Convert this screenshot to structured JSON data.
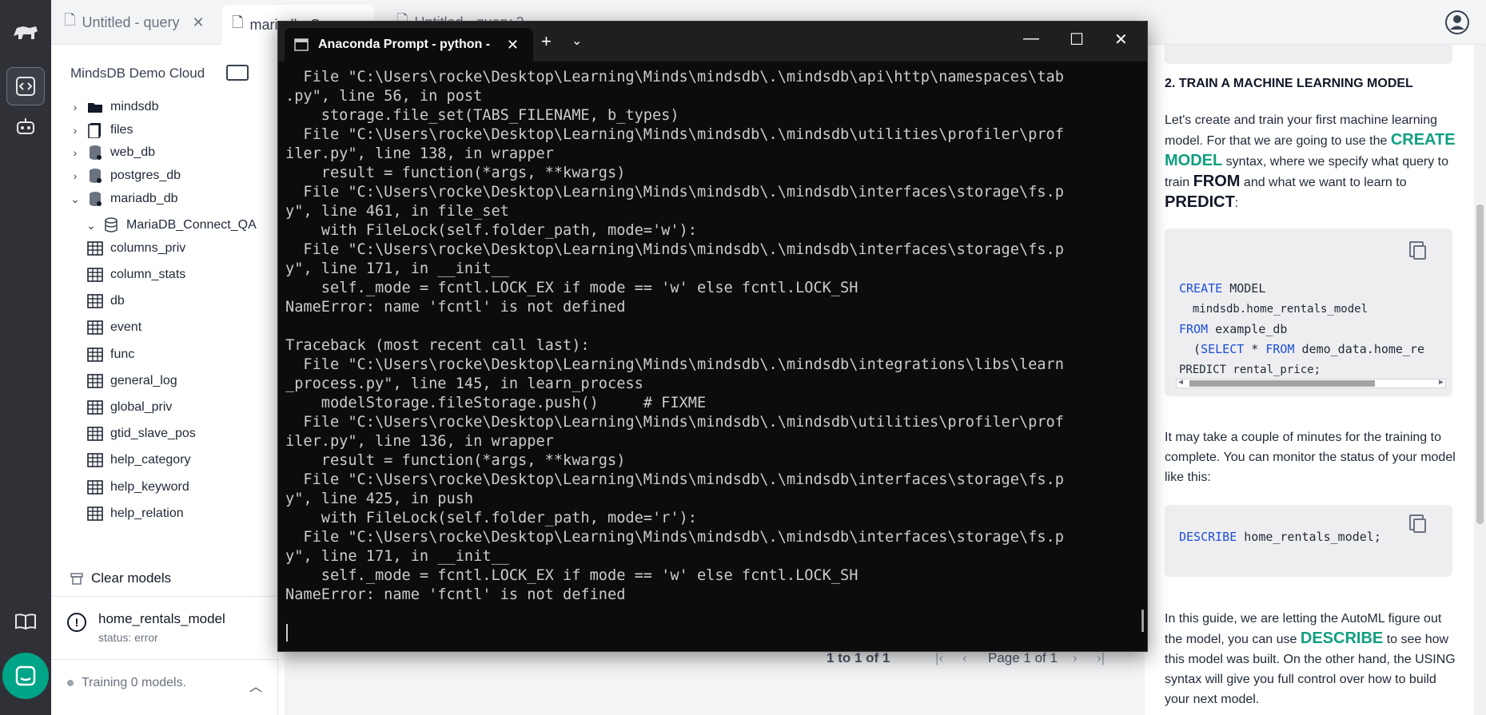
{
  "tabs": [
    {
      "label": "Untitled - query"
    },
    {
      "label": "mariadb_Conne..."
    },
    {
      "label": "Untitled - query 2"
    }
  ],
  "sidebar": {
    "title": "MindsDB Demo Cloud",
    "tree": [
      {
        "label": "mindsdb",
        "kind": "folder"
      },
      {
        "label": "files",
        "kind": "files"
      },
      {
        "label": "web_db",
        "kind": "db"
      },
      {
        "label": "postgres_db",
        "kind": "db"
      },
      {
        "label": "mariadb_db",
        "kind": "db"
      },
      {
        "label": "MariaDB_Connect_QA",
        "kind": "db"
      },
      {
        "label": "columns_priv",
        "kind": "table"
      },
      {
        "label": "column_stats",
        "kind": "table"
      },
      {
        "label": "db",
        "kind": "table"
      },
      {
        "label": "event",
        "kind": "table"
      },
      {
        "label": "func",
        "kind": "table"
      },
      {
        "label": "general_log",
        "kind": "table"
      },
      {
        "label": "global_priv",
        "kind": "table"
      },
      {
        "label": "gtid_slave_pos",
        "kind": "table"
      },
      {
        "label": "help_category",
        "kind": "table"
      },
      {
        "label": "help_keyword",
        "kind": "table"
      },
      {
        "label": "help_relation",
        "kind": "table"
      }
    ],
    "clear_models": "Clear models",
    "model": {
      "name": "home_rentals_model",
      "status": "status: error"
    },
    "training": "Training 0 models."
  },
  "results": {
    "range": "1 to 1 of 1",
    "page": "Page 1 of 1"
  },
  "terminal": {
    "title": "Anaconda Prompt - python -",
    "lines": [
      "  File \"C:\\Users\\rocke\\Desktop\\Learning\\Minds\\mindsdb\\.\\mindsdb\\api\\http\\namespaces\\tab",
      ".py\", line 56, in post",
      "    storage.file_set(TABS_FILENAME, b_types)",
      "  File \"C:\\Users\\rocke\\Desktop\\Learning\\Minds\\mindsdb\\.\\mindsdb\\utilities\\profiler\\prof",
      "iler.py\", line 138, in wrapper",
      "    result = function(*args, **kwargs)",
      "  File \"C:\\Users\\rocke\\Desktop\\Learning\\Minds\\mindsdb\\.\\mindsdb\\interfaces\\storage\\fs.p",
      "y\", line 461, in file_set",
      "    with FileLock(self.folder_path, mode='w'):",
      "  File \"C:\\Users\\rocke\\Desktop\\Learning\\Minds\\mindsdb\\.\\mindsdb\\interfaces\\storage\\fs.p",
      "y\", line 171, in __init__",
      "    self._mode = fcntl.LOCK_EX if mode == 'w' else fcntl.LOCK_SH",
      "NameError: name 'fcntl' is not defined",
      "",
      "Traceback (most recent call last):",
      "  File \"C:\\Users\\rocke\\Desktop\\Learning\\Minds\\mindsdb\\.\\mindsdb\\integrations\\libs\\learn",
      "_process.py\", line 145, in learn_process",
      "    modelStorage.fileStorage.push()     # FIXME",
      "  File \"C:\\Users\\rocke\\Desktop\\Learning\\Minds\\mindsdb\\.\\mindsdb\\utilities\\profiler\\prof",
      "iler.py\", line 136, in wrapper",
      "    result = function(*args, **kwargs)",
      "  File \"C:\\Users\\rocke\\Desktop\\Learning\\Minds\\mindsdb\\.\\mindsdb\\interfaces\\storage\\fs.p",
      "y\", line 425, in push",
      "    with FileLock(self.folder_path, mode='r'):",
      "  File \"C:\\Users\\rocke\\Desktop\\Learning\\Minds\\mindsdb\\.\\mindsdb\\interfaces\\storage\\fs.p",
      "y\", line 171, in __init__",
      "    self._mode = fcntl.LOCK_EX if mode == 'w' else fcntl.LOCK_SH",
      "NameError: name 'fcntl' is not defined"
    ]
  },
  "guide": {
    "heading": "2. TRAIN A MACHINE LEARNING MODEL",
    "p1_a": "Let's create and train your first machine learning model. For that we are going to use the ",
    "p1_kw1": "CREATE MODEL",
    "p1_b": " syntax, where we specify what query to train ",
    "p1_kw2": "FROM",
    "p1_c": " and what we want to learn to ",
    "p1_kw3": "PREDICT",
    "p1_d": ":",
    "code1": {
      "l1_kw": "CREATE",
      "l1_rest": " MODEL",
      "l2": "  mindsdb.home_rentals_model",
      "l3_kw": "FROM",
      "l3_rest": " example_db",
      "l4_pre": "  (",
      "l4_kw1": "SELECT",
      "l4_mid": " * ",
      "l4_kw2": "FROM",
      "l4_rest": " demo_data.home_re",
      "l5": "PREDICT rental_price;"
    },
    "p2": "It may take a couple of minutes for the training to complete. You can monitor the status of your model like this:",
    "code2": {
      "kw": "DESCRIBE",
      "rest": " home_rentals_model;"
    },
    "p3_a": "In this guide, we are letting the AutoML figure out the model, you can use ",
    "p3_kw": "DESCRIBE",
    "p3_b": " to see how this model was built. On the other hand, the USING syntax will give you full control over how to build your next model."
  }
}
